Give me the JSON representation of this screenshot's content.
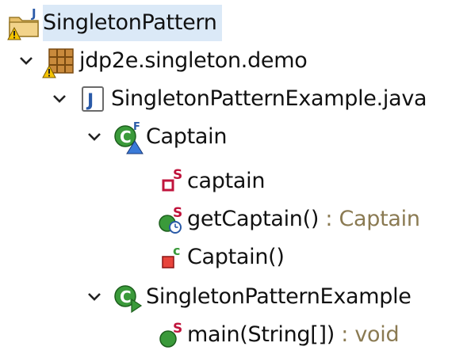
{
  "tree": {
    "project": {
      "label": "SingletonPattern",
      "icon": "java-project-warning-icon"
    },
    "package": {
      "label": "jdp2e.singleton.demo",
      "icon": "package-warning-icon",
      "expanded": true
    },
    "file": {
      "label": "SingletonPatternExample.java",
      "icon": "java-file-icon",
      "expanded": true
    },
    "class_captain": {
      "label": "Captain",
      "icon": "final-class-icon",
      "expanded": true
    },
    "field_captain": {
      "label": "captain",
      "icon": "private-static-field-icon"
    },
    "method_getcaptain": {
      "label": "getCaptain()",
      "separator": " : ",
      "return_type": "Captain",
      "icon": "static-synchronized-method-icon"
    },
    "constructor_captain": {
      "label": "Captain()",
      "icon": "private-constructor-icon"
    },
    "class_example": {
      "label": "SingletonPatternExample",
      "icon": "runnable-class-icon",
      "expanded": true
    },
    "method_main": {
      "label": "main(String[])",
      "separator": " : ",
      "return_type": "void",
      "icon": "public-static-method-icon"
    }
  },
  "colors": {
    "selection": "#dbe9f7",
    "return_type": "#8a7a52",
    "class_green": "#3a9a3a",
    "static_red": "#c0143c",
    "java_blue": "#2a5aa8",
    "warning_yellow": "#f5c400"
  }
}
